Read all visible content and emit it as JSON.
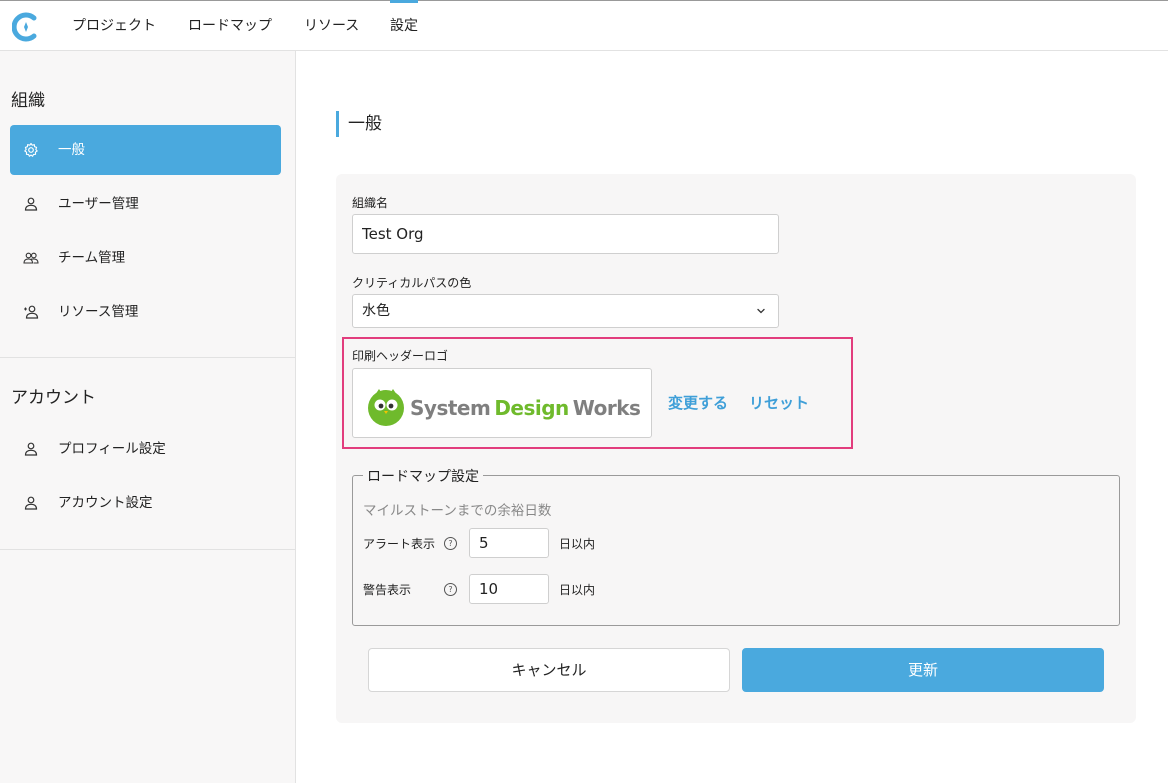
{
  "nav": {
    "items": [
      {
        "label": "プロジェクト"
      },
      {
        "label": "ロードマップ"
      },
      {
        "label": "リソース"
      },
      {
        "label": "設定"
      }
    ],
    "active": "設定"
  },
  "sidebar": {
    "org_heading": "組織",
    "org_items": [
      {
        "label": "一般",
        "icon": "gear-icon"
      },
      {
        "label": "ユーザー管理",
        "icon": "user-icon"
      },
      {
        "label": "チーム管理",
        "icon": "team-icon"
      },
      {
        "label": "リソース管理",
        "icon": "resource-user-icon"
      }
    ],
    "account_heading": "アカウント",
    "account_items": [
      {
        "label": "プロフィール設定",
        "icon": "user-icon"
      },
      {
        "label": "アカウント設定",
        "icon": "user-icon"
      }
    ]
  },
  "main": {
    "title": "一般",
    "org_name": {
      "label": "組織名",
      "value": "Test Org"
    },
    "critical_path": {
      "label": "クリティカルパスの色",
      "value": "水色"
    },
    "print_logo": {
      "label": "印刷ヘッダーロゴ",
      "logo_text": "System Design Works",
      "logo_text_a": "System",
      "logo_text_b": "Design",
      "logo_text_c": "Works",
      "change_label": "変更する",
      "reset_label": "リセット"
    },
    "roadmap": {
      "legend": "ロードマップ設定",
      "sublabel": "マイルストーンまでの余裕日数",
      "alert": {
        "label": "アラート表示",
        "value": "5",
        "unit": "日以内"
      },
      "warning": {
        "label": "警告表示",
        "value": "10",
        "unit": "日以内"
      },
      "help_glyph": "?"
    },
    "cancel_label": "キャンセル",
    "update_label": "更新"
  },
  "colors": {
    "accent": "#4aa9de",
    "highlight": "#e23d7d",
    "logo_green": "#6fba2c"
  }
}
